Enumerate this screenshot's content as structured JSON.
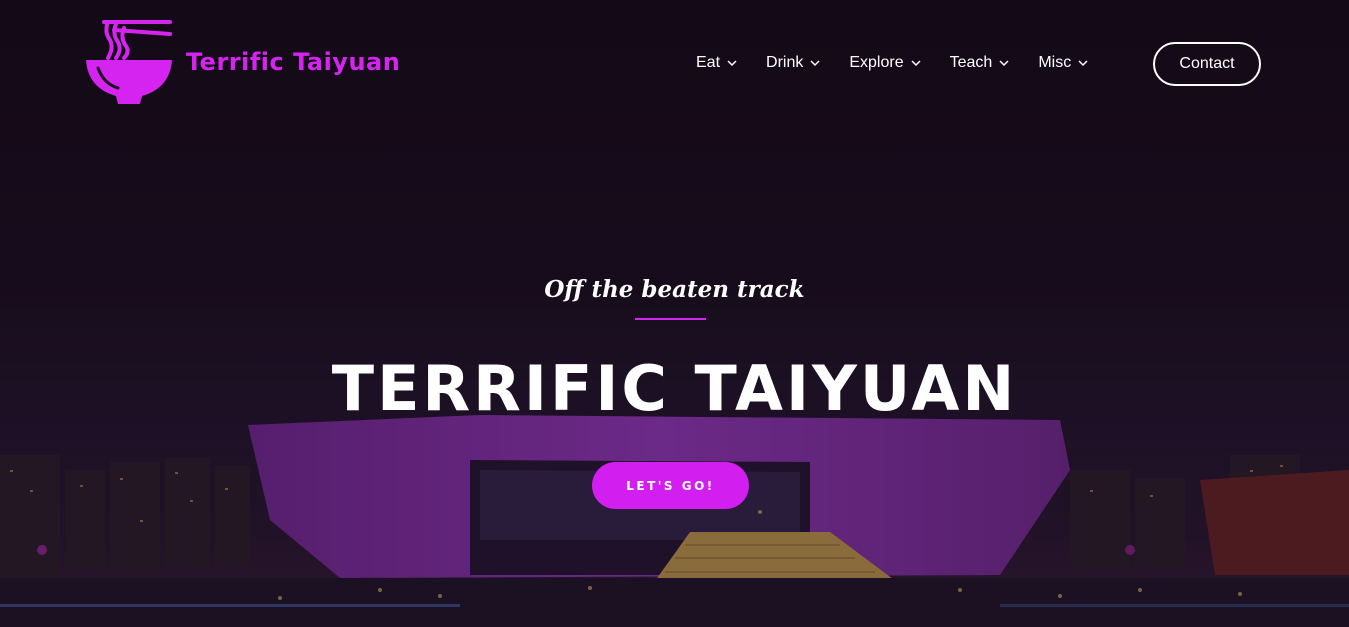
{
  "brand": {
    "name": "Terrific Taiyuan",
    "logo_icon": "noodle-bowl-icon",
    "color": "#d624f0"
  },
  "nav": {
    "items": [
      {
        "label": "Eat",
        "icon": "chevron-down-icon"
      },
      {
        "label": "Drink",
        "icon": "chevron-down-icon"
      },
      {
        "label": "Explore",
        "icon": "chevron-down-icon"
      },
      {
        "label": "Teach",
        "icon": "chevron-down-icon"
      },
      {
        "label": "Misc",
        "icon": "chevron-down-icon"
      }
    ],
    "contact_label": "Contact"
  },
  "hero": {
    "tagline": "Off the beaten track",
    "title": "TERRIFIC TAIYUAN",
    "cta_label": "LET'S GO!",
    "accent_color": "#d21ff0"
  }
}
